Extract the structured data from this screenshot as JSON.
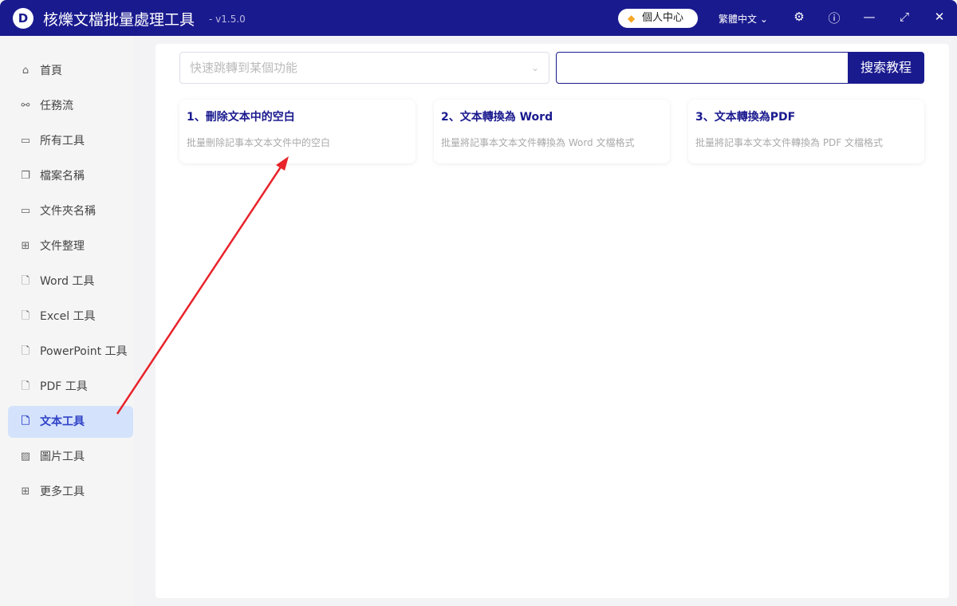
{
  "app": {
    "logo": "D",
    "title": "核爍文檔批量處理工具",
    "version": "- v1.5.0",
    "user_center": "個人中心",
    "language": "繁體中文"
  },
  "sidebar": {
    "items": [
      {
        "label": "首頁",
        "icon": "home-icon",
        "glyph": "⌂"
      },
      {
        "label": "任務流",
        "icon": "workflow-icon",
        "glyph": "⚯"
      },
      {
        "label": "所有工具",
        "icon": "monitor-icon",
        "glyph": "▭"
      },
      {
        "label": "檔案名稱",
        "icon": "files-icon",
        "glyph": "❐"
      },
      {
        "label": "文件夾名稱",
        "icon": "folder-icon",
        "glyph": "▭"
      },
      {
        "label": "文件整理",
        "icon": "organize-icon",
        "glyph": "⊞"
      },
      {
        "label": "Word 工具",
        "icon": "word-file-icon",
        "glyph": "🗋"
      },
      {
        "label": "Excel 工具",
        "icon": "excel-file-icon",
        "glyph": "🗋"
      },
      {
        "label": "PowerPoint 工具",
        "icon": "ppt-file-icon",
        "glyph": "🗋"
      },
      {
        "label": "PDF 工具",
        "icon": "pdf-file-icon",
        "glyph": "🗋"
      },
      {
        "label": "文本工具",
        "icon": "text-file-icon",
        "glyph": "🗋"
      },
      {
        "label": "圖片工具",
        "icon": "image-icon",
        "glyph": "▨"
      },
      {
        "label": "更多工具",
        "icon": "grid-icon",
        "glyph": "⊞"
      }
    ],
    "active": 10
  },
  "toolbar": {
    "jump_placeholder": "快速跳轉到某個功能",
    "search_value": "",
    "search_button": "搜索教程"
  },
  "cards": [
    {
      "title": "1、刪除文本中的空白",
      "desc": "批量刪除記事本文本文件中的空白"
    },
    {
      "title": "2、文本轉換為 Word",
      "desc": "批量將記事本文本文件轉換為 Word 文檔格式"
    },
    {
      "title": "3、文本轉換為PDF",
      "desc": "批量將記事本文本文件轉換為 PDF 文檔格式"
    }
  ],
  "colors": {
    "brand": "#1a1a8f",
    "active_bg": "#d4e3fb",
    "annotation": "#e8232a"
  }
}
